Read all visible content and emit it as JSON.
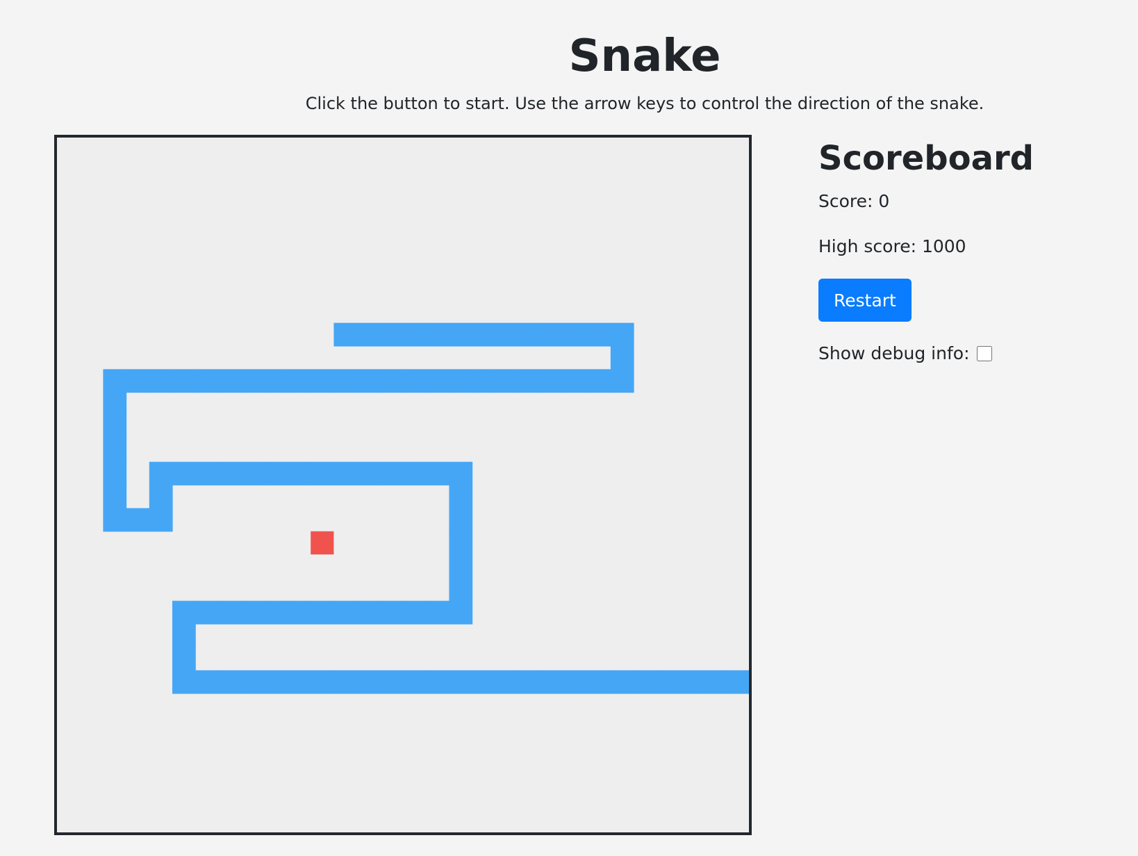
{
  "header": {
    "title": "Snake",
    "instructions": "Click the button to start. Use the arrow keys to control the direction of the snake."
  },
  "scoreboard": {
    "title": "Scoreboard",
    "score_text": "Score: 0",
    "high_score_text": "High score: 1000",
    "restart_label": "Restart",
    "debug_label": "Show debug info:",
    "debug_checked": false
  },
  "game": {
    "grid_columns": 30,
    "grid_rows": 30,
    "snake_color": "#45a6f6",
    "food_color": "#f0534e",
    "board_background": "#eeeeee",
    "board_border_color": "#23272e",
    "snake_segments": [
      [
        12,
        8
      ],
      [
        13,
        8
      ],
      [
        14,
        8
      ],
      [
        15,
        8
      ],
      [
        16,
        8
      ],
      [
        17,
        8
      ],
      [
        18,
        8
      ],
      [
        19,
        8
      ],
      [
        20,
        8
      ],
      [
        21,
        8
      ],
      [
        22,
        8
      ],
      [
        23,
        8
      ],
      [
        24,
        8
      ],
      [
        24,
        9
      ],
      [
        24,
        10
      ],
      [
        23,
        10
      ],
      [
        22,
        10
      ],
      [
        21,
        10
      ],
      [
        20,
        10
      ],
      [
        19,
        10
      ],
      [
        18,
        10
      ],
      [
        17,
        10
      ],
      [
        16,
        10
      ],
      [
        15,
        10
      ],
      [
        14,
        10
      ],
      [
        13,
        10
      ],
      [
        12,
        10
      ],
      [
        11,
        10
      ],
      [
        10,
        10
      ],
      [
        9,
        10
      ],
      [
        8,
        10
      ],
      [
        7,
        10
      ],
      [
        6,
        10
      ],
      [
        5,
        10
      ],
      [
        4,
        10
      ],
      [
        3,
        10
      ],
      [
        2,
        10
      ],
      [
        2,
        11
      ],
      [
        2,
        12
      ],
      [
        2,
        13
      ],
      [
        2,
        14
      ],
      [
        2,
        15
      ],
      [
        2,
        16
      ],
      [
        3,
        16
      ],
      [
        4,
        16
      ],
      [
        4,
        15
      ],
      [
        4,
        14
      ],
      [
        5,
        14
      ],
      [
        6,
        14
      ],
      [
        7,
        14
      ],
      [
        8,
        14
      ],
      [
        9,
        14
      ],
      [
        10,
        14
      ],
      [
        11,
        14
      ],
      [
        12,
        14
      ],
      [
        13,
        14
      ],
      [
        14,
        14
      ],
      [
        15,
        14
      ],
      [
        16,
        14
      ],
      [
        17,
        14
      ],
      [
        17,
        15
      ],
      [
        17,
        16
      ],
      [
        17,
        17
      ],
      [
        17,
        18
      ],
      [
        17,
        19
      ],
      [
        17,
        20
      ],
      [
        16,
        20
      ],
      [
        15,
        20
      ],
      [
        14,
        20
      ],
      [
        13,
        20
      ],
      [
        12,
        20
      ],
      [
        11,
        20
      ],
      [
        10,
        20
      ],
      [
        9,
        20
      ],
      [
        8,
        20
      ],
      [
        7,
        20
      ],
      [
        6,
        20
      ],
      [
        5,
        20
      ],
      [
        5,
        21
      ],
      [
        5,
        22
      ],
      [
        5,
        23
      ],
      [
        6,
        23
      ],
      [
        7,
        23
      ],
      [
        8,
        23
      ],
      [
        9,
        23
      ],
      [
        10,
        23
      ],
      [
        11,
        23
      ],
      [
        12,
        23
      ],
      [
        13,
        23
      ],
      [
        14,
        23
      ],
      [
        15,
        23
      ],
      [
        16,
        23
      ],
      [
        17,
        23
      ],
      [
        18,
        23
      ],
      [
        19,
        23
      ],
      [
        20,
        23
      ],
      [
        21,
        23
      ],
      [
        22,
        23
      ],
      [
        23,
        23
      ],
      [
        24,
        23
      ],
      [
        25,
        23
      ],
      [
        26,
        23
      ],
      [
        27,
        23
      ],
      [
        28,
        23
      ],
      [
        29,
        23
      ]
    ],
    "food": [
      11,
      17
    ]
  }
}
